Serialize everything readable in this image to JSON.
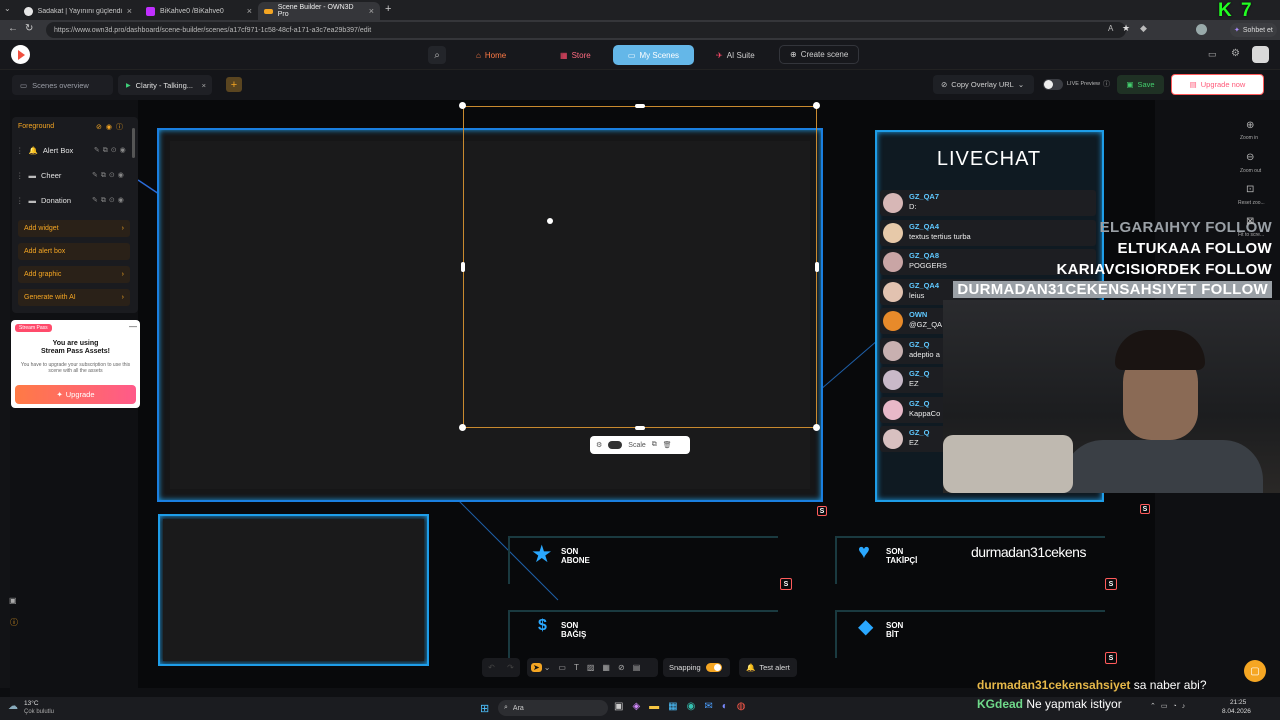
{
  "browser": {
    "tabs": [
      {
        "title": "Sadakat | Yayınını güçlendirmek iç"
      },
      {
        "title": "BiKahve0 /BiKahve0"
      },
      {
        "title": "Scene Builder - OWN3D Pro"
      }
    ],
    "new_tab": "+",
    "url": "https://www.own3d.pro/dashboard/scene-builder/scenes/a17cf971-1c58-48cf-a171-a3c7ea29b397/edit",
    "chat_button": "Sohbet et",
    "overlay_badge": "K 7"
  },
  "nav": {
    "home": "Home",
    "store": "Store",
    "my_scenes": "My Scenes",
    "ai_suite": "AI Suite",
    "create_scene": "Create scene"
  },
  "toolbar": {
    "scenes_overview": "Scenes overview",
    "current_tab": "Clarity - Talking...",
    "add_tab": "+",
    "copy_overlay": "Copy Overlay URL",
    "live_preview": "LIVE Preview",
    "save": "Save",
    "upgrade": "Upgrade now"
  },
  "layers": {
    "header": "Foreground",
    "items": [
      {
        "label": "Alert Box"
      },
      {
        "label": "Cheer"
      },
      {
        "label": "Donation"
      }
    ],
    "actions": [
      {
        "label": "Add widget"
      },
      {
        "label": "Add alert box"
      },
      {
        "label": "Add graphic"
      },
      {
        "label": "Generate with AI"
      }
    ]
  },
  "promo": {
    "badge": "Stream Pass",
    "title": "You are using",
    "title2": "Stream Pass Assets!",
    "body": "You have to upgrade your subscription to use this scene with all the assets",
    "button": "Upgrade"
  },
  "selection_toolbar": {
    "scale": "Scale"
  },
  "right_tools": [
    {
      "label": "Zoom in"
    },
    {
      "label": "Zoom out"
    },
    {
      "label": "Reset zoo..."
    },
    {
      "label": "Fit to scre..."
    }
  ],
  "livechat": {
    "title": "LIVECHAT",
    "messages": [
      {
        "name": "GZ_QA7",
        "text": "D:"
      },
      {
        "name": "GZ_QA4",
        "text": "textus tertius turba"
      },
      {
        "name": "GZ_QA8",
        "text": "POGGERS"
      },
      {
        "name": "GZ_QA4",
        "text": "leius"
      },
      {
        "name": "OWN",
        "text": "@GZ_QA"
      },
      {
        "name": "GZ_Q",
        "text": "adeptio a"
      },
      {
        "name": "GZ_Q",
        "text": "EZ"
      },
      {
        "name": "GZ_Q",
        "text": "KappaCo"
      },
      {
        "name": "GZ_Q",
        "text": "EZ"
      }
    ]
  },
  "follows": [
    {
      "text": "ELGARAIHYY FOLLOW"
    },
    {
      "text": "ELTUKAAA FOLLOW"
    },
    {
      "text": "KARIAVCISIORDEK FOLLOW"
    },
    {
      "text": "DURMADAN31CEKENSAHSIYET FOLLOW"
    }
  ],
  "widgets": {
    "son_abone": [
      "SON",
      "ABONE"
    ],
    "son_takipci": [
      "SON",
      "TAKİPÇİ"
    ],
    "takipci_name": "durmadan31cekens",
    "son_bagis": [
      "SON",
      "BAĞIŞ"
    ],
    "son_bit": [
      "SON",
      "BİT"
    ]
  },
  "bottom_toolbar": {
    "snapping": "Snapping",
    "test_alert": "Test alert"
  },
  "stream_chat": [
    {
      "user": "durmadan31cekensahsiyet",
      "text": "sa naber abi?"
    },
    {
      "user": "KGdead",
      "text": "Ne yapmak istiyor"
    }
  ],
  "taskbar": {
    "weather_temp": "13°C",
    "weather_desc": "Çok bulutlu",
    "search": "Ara",
    "time": "21:25",
    "date": "8.04.2026"
  },
  "colors": {
    "accent": "#1e9de8",
    "orange": "#f5a623",
    "chat_name": "#5fc8ff",
    "follow_highlight": "#9aa0a6"
  }
}
